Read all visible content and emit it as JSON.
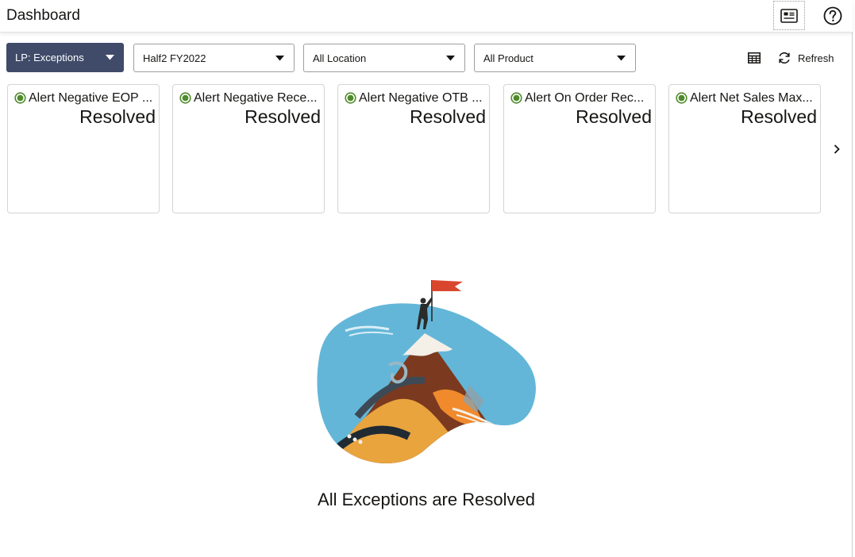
{
  "header": {
    "title": "Dashboard",
    "widget_icon": "widget-icon",
    "help_icon": "help-icon"
  },
  "toolbar": {
    "scope": "LP: Exceptions",
    "period": "Half2 FY2022",
    "location": "All Location",
    "product": "All Product",
    "refresh_label": "Refresh",
    "table_icon": "table-icon",
    "refresh_icon": "refresh-icon"
  },
  "tiles": [
    {
      "name": "Alert Negative EOP ...",
      "value": "Resolved"
    },
    {
      "name": "Alert Negative Rece...",
      "value": "Resolved"
    },
    {
      "name": "Alert Negative OTB ...",
      "value": "Resolved"
    },
    {
      "name": "Alert On Order Rec...",
      "value": "Resolved"
    },
    {
      "name": "Alert Net Sales Max...",
      "value": "Resolved"
    }
  ],
  "colors": {
    "accent": "#3f4b69",
    "status_ok": "#4f8a2b"
  },
  "empty_state": {
    "message": "All Exceptions are Resolved"
  }
}
